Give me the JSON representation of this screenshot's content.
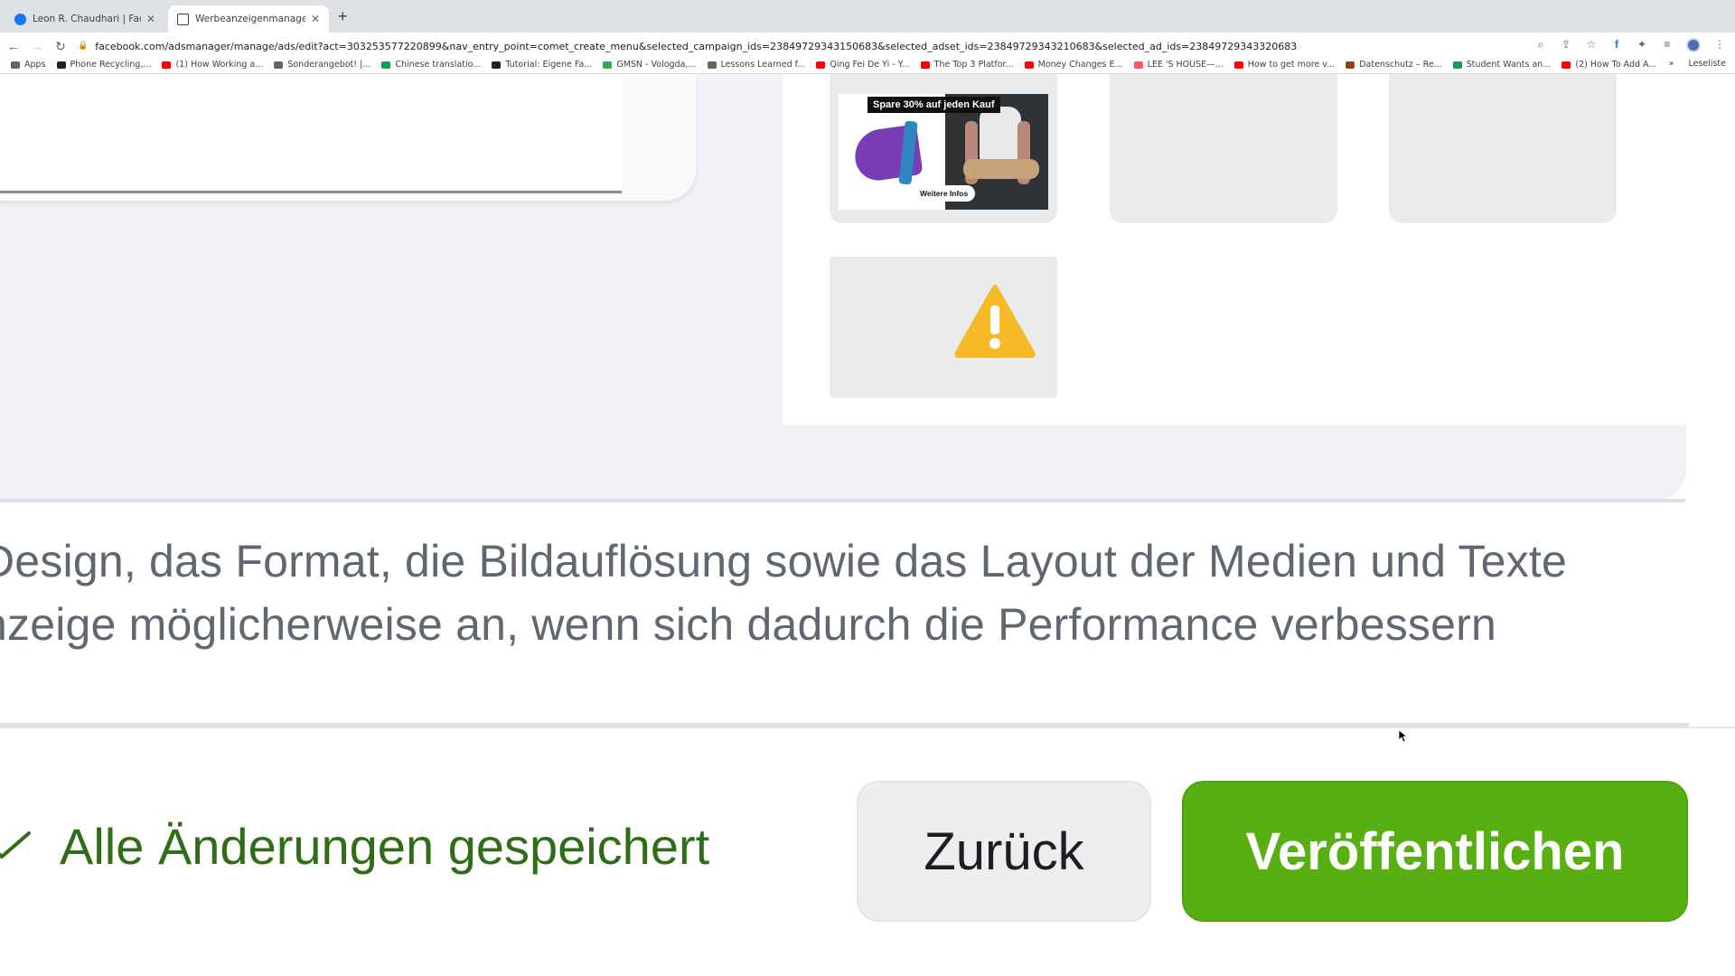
{
  "browser": {
    "tabs": [
      {
        "title": "Leon R. Chaudhari | Facebook",
        "active": false
      },
      {
        "title": "Werbeanzeigenmanager - Wer",
        "active": true
      }
    ],
    "new_tab": "+",
    "url": "facebook.com/adsmanager/manage/ads/edit?act=303253577220899&nav_entry_point=comet_create_menu&selected_campaign_ids=23849729343150683&selected_adset_ids=23849729343210683&selected_ad_ids=23849729343320683",
    "bookmarks": [
      {
        "label": "Apps",
        "color": "#5f6368"
      },
      {
        "label": "Phone Recycling,...",
        "color": "#202124"
      },
      {
        "label": "(1) How Working a...",
        "color": "#ff0000"
      },
      {
        "label": "Sonderangebot! |...",
        "color": "#5f6368"
      },
      {
        "label": "Chinese translatio...",
        "color": "#0f9d58"
      },
      {
        "label": "Tutorial: Eigene Fa...",
        "color": "#202124"
      },
      {
        "label": "GMSN - Vologda,...",
        "color": "#34a853"
      },
      {
        "label": "Lessons Learned f...",
        "color": "#5f6368"
      },
      {
        "label": "Qing Fei De Yi - Y...",
        "color": "#ff0000"
      },
      {
        "label": "The Top 3 Platfor...",
        "color": "#ff0000"
      },
      {
        "label": "Money Changes E...",
        "color": "#ff0000"
      },
      {
        "label": "LEE 'S HOUSE—...",
        "color": "#ff5a5f"
      },
      {
        "label": "How to get more v...",
        "color": "#ff0000"
      },
      {
        "label": "Datenschutz – Re...",
        "color": "#8b4513"
      },
      {
        "label": "Student Wants an...",
        "color": "#0f9d58"
      },
      {
        "label": "(2) How To Add A...",
        "color": "#ff0000"
      }
    ],
    "bookmarks_overflow": "»",
    "reading_list": "Leseliste"
  },
  "preview": {
    "ad_badge": "Spare 30% auf jeden Kauf",
    "ad_cta": "Weitere Infos"
  },
  "description": {
    "line1": "Design, das Format, die Bildauflösung sowie das Layout der Medien und Texte",
    "line2": "nzeige möglicherweise an, wenn sich dadurch die Performance verbessern"
  },
  "footer": {
    "saved_status": "Alle Änderungen gespeichert",
    "back_label": "Zurück",
    "publish_label": "Veröffentlichen"
  },
  "colors": {
    "publish": "#57af12",
    "saved_text": "#2f6d16",
    "warning": "#f7b928"
  }
}
